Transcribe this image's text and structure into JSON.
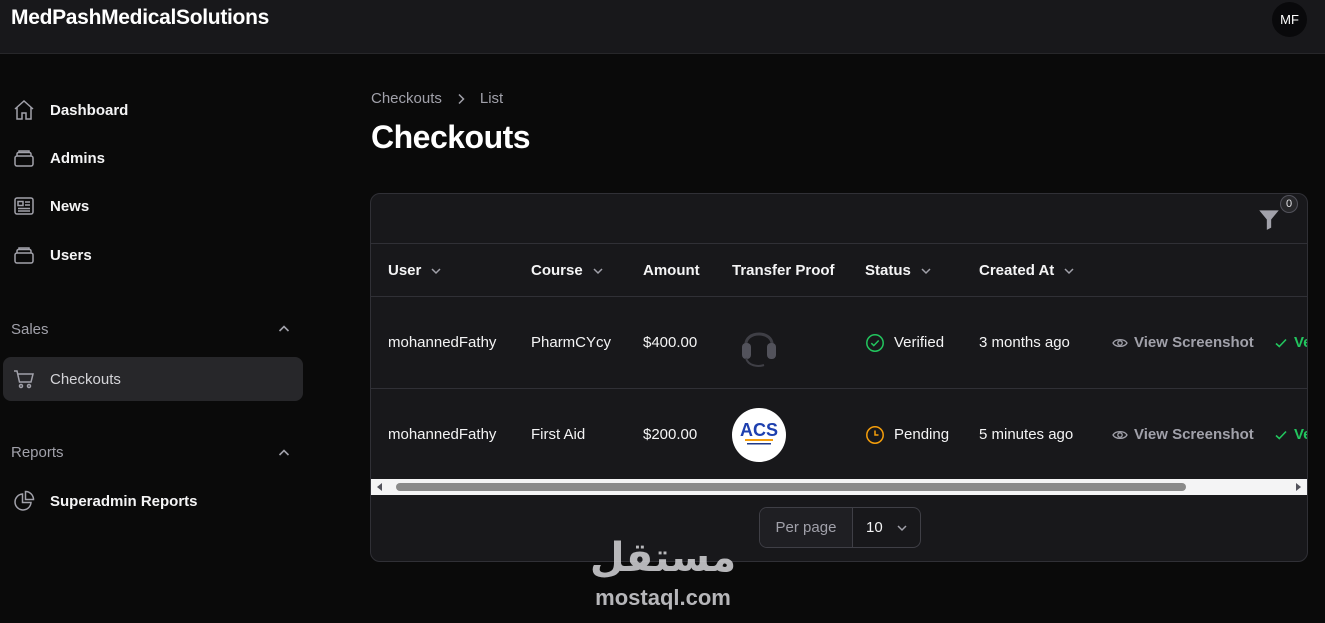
{
  "app": {
    "brand": "MedPashMedicalSolutions",
    "avatar_initials": "MF"
  },
  "sidebar": {
    "items": [
      {
        "label": "Dashboard",
        "icon": "home-icon"
      },
      {
        "label": "Admins",
        "icon": "stack-icon"
      },
      {
        "label": "News",
        "icon": "newspaper-icon"
      },
      {
        "label": "Users",
        "icon": "stack-icon"
      }
    ],
    "groups": [
      {
        "label": "Sales",
        "items": [
          {
            "label": "Checkouts",
            "icon": "cart-icon",
            "active": true
          }
        ]
      },
      {
        "label": "Reports",
        "items": [
          {
            "label": "Superadmin Reports",
            "icon": "pie-chart-icon"
          }
        ]
      }
    ]
  },
  "breadcrumb": {
    "parent": "Checkouts",
    "current": "List"
  },
  "page": {
    "title": "Checkouts"
  },
  "table": {
    "filter_count": "0",
    "columns": [
      {
        "label": "User",
        "sortable": true
      },
      {
        "label": "Course",
        "sortable": true
      },
      {
        "label": "Amount",
        "sortable": false
      },
      {
        "label": "Transfer Proof",
        "sortable": false
      },
      {
        "label": "Status",
        "sortable": true
      },
      {
        "label": "Created At",
        "sortable": true
      }
    ],
    "rows": [
      {
        "user": "mohannedFathy",
        "course": "PharmCYcy",
        "amount": "$400.00",
        "proof_icon": "headset-thumbnail",
        "status": "Verified",
        "status_icon": "check-circle-icon",
        "created_at": "3 months ago",
        "view_action": "View Screenshot",
        "verify_action": "Ve"
      },
      {
        "user": "mohannedFathy",
        "course": "First Aid",
        "amount": "$200.00",
        "proof_icon": "acs-logo-thumbnail",
        "proof_logo_text": "ACS",
        "status": "Pending",
        "status_icon": "clock-icon",
        "created_at": "5 minutes ago",
        "view_action": "View Screenshot",
        "verify_action": "Ve"
      }
    ],
    "pagination": {
      "per_page_label": "Per page",
      "per_page_value": "10"
    }
  },
  "colors": {
    "verified": "#22c55e",
    "pending": "#f59e0b",
    "background": "#0a0a0a",
    "surface": "#18181b"
  },
  "watermark": {
    "arabic": "مستقل",
    "latin": "mostaql.com"
  }
}
